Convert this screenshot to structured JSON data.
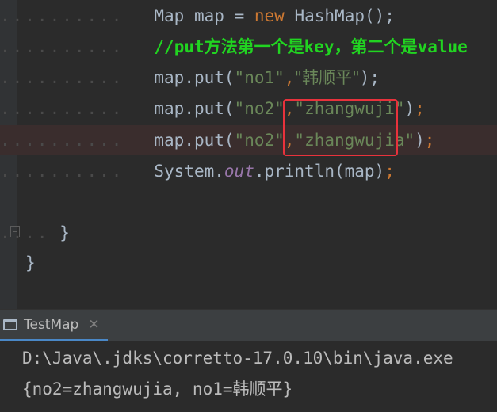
{
  "editor": {
    "line1": {
      "type": "Map",
      "var": "map",
      "eq": "=",
      "kw_new": "new",
      "ctor": "HashMap();"
    },
    "line2": {
      "slashes": "//",
      "put": "put",
      "zh1": "方法第一个是",
      "key": "key",
      "zh2": "，第二个是",
      "value": "value"
    },
    "line3": {
      "call": "map.put(",
      "arg1": "\"no1\"",
      "comma": ",",
      "arg2": "\"韩顺平\"",
      "end": ");"
    },
    "line4": {
      "call": "map.put(",
      "arg1": "\"no2\"",
      "comma": ",",
      "arg2": "\"zhangwuji\"",
      "close": ")",
      "semi": ";"
    },
    "line5": {
      "call": "map.put(",
      "arg1": "\"no2\"",
      "comma": ",",
      "arg2": "\"zhangwujia\"",
      "close": ")",
      "semi": ";"
    },
    "line6": {
      "system": "System.",
      "out": "out",
      "rest": ".println(map)",
      "semi": ";"
    },
    "line8": {
      "brace": "}"
    },
    "line9": {
      "brace": "}"
    }
  },
  "run_panel": {
    "tab_label": "TestMap",
    "close_glyph": "✕"
  },
  "console": {
    "command_line": "D:\\Java\\.jdks\\corretto-17.0.10\\bin\\java.exe",
    "output_line": "{no2=zhangwujia, no1=韩顺平}"
  },
  "colors": {
    "keyword": "#cc7832",
    "string": "#6a8759",
    "comment": "#21d421",
    "field": "#9876aa",
    "highlight_box": "#e8323c"
  }
}
